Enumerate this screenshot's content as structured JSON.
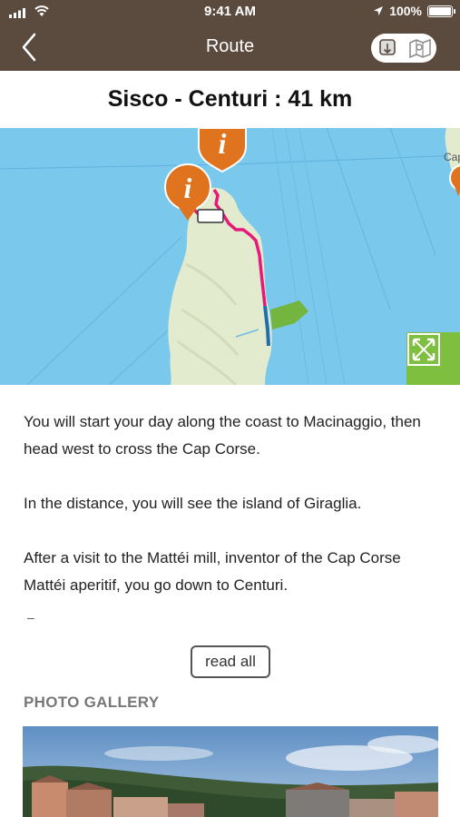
{
  "status_bar": {
    "time": "9:41 AM",
    "battery": "100%",
    "battery_level": 1.0
  },
  "nav": {
    "title": "Route",
    "back_icon": "chevron-left-icon",
    "toggle_icons": [
      "download-icon",
      "map-icon"
    ]
  },
  "route": {
    "title": "Sisco - Centuri : 41 km"
  },
  "map": {
    "labels": [
      "Cap"
    ],
    "markers": [
      "info-marker",
      "info-marker",
      "info-marker"
    ],
    "colors": {
      "sea": "#7ac8ec",
      "land": "#e3ebcf",
      "route": "#e6197a",
      "marker": "#e0731d",
      "expand": "#7fbf3f"
    }
  },
  "description": {
    "paragraphs": [
      "You will start your day along the coast to Macinaggio, then head west to cross the Cap Corse.",
      "In the distance, you will see the island of Giraglia.",
      "After a visit to the Mattéi mill, inventor of the Cap Corse Mattéi aperitif, you go down to Centuri."
    ],
    "ellipsis": "–",
    "read_all": "read all"
  },
  "gallery": {
    "title": "PHOTO GALLERY"
  }
}
